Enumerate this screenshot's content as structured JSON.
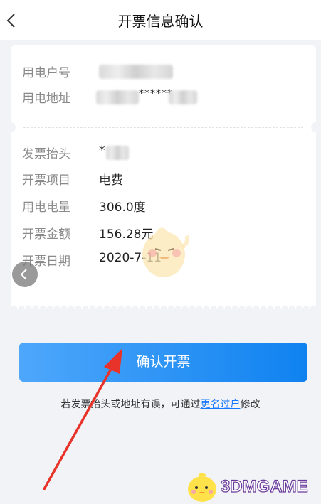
{
  "header": {
    "title": "开票信息确认"
  },
  "account": {
    "number_label": "用电户号",
    "number_value": "",
    "address_label": "用电地址",
    "address_value_masked": "******"
  },
  "invoice": {
    "title_label": "发票抬头",
    "title_value": "*",
    "item_label": "开票项目",
    "item_value": "电费",
    "usage_label": "用电电量",
    "usage_value": "306.0度",
    "amount_label": "开票金额",
    "amount_value": "156.28元",
    "date_label": "开票日期",
    "date_value": "2020-7-11"
  },
  "actions": {
    "confirm_label": "确认开票"
  },
  "hint": {
    "prefix": "若发票抬头或地址有误，可通过",
    "link": "更名过户",
    "suffix": "修改"
  },
  "watermark": {
    "text": "3DMGAME"
  },
  "colors": {
    "accent": "#1677ff",
    "button_start": "#4ea7fb",
    "button_end": "#0f82f0",
    "arrow": "#e8332b"
  }
}
